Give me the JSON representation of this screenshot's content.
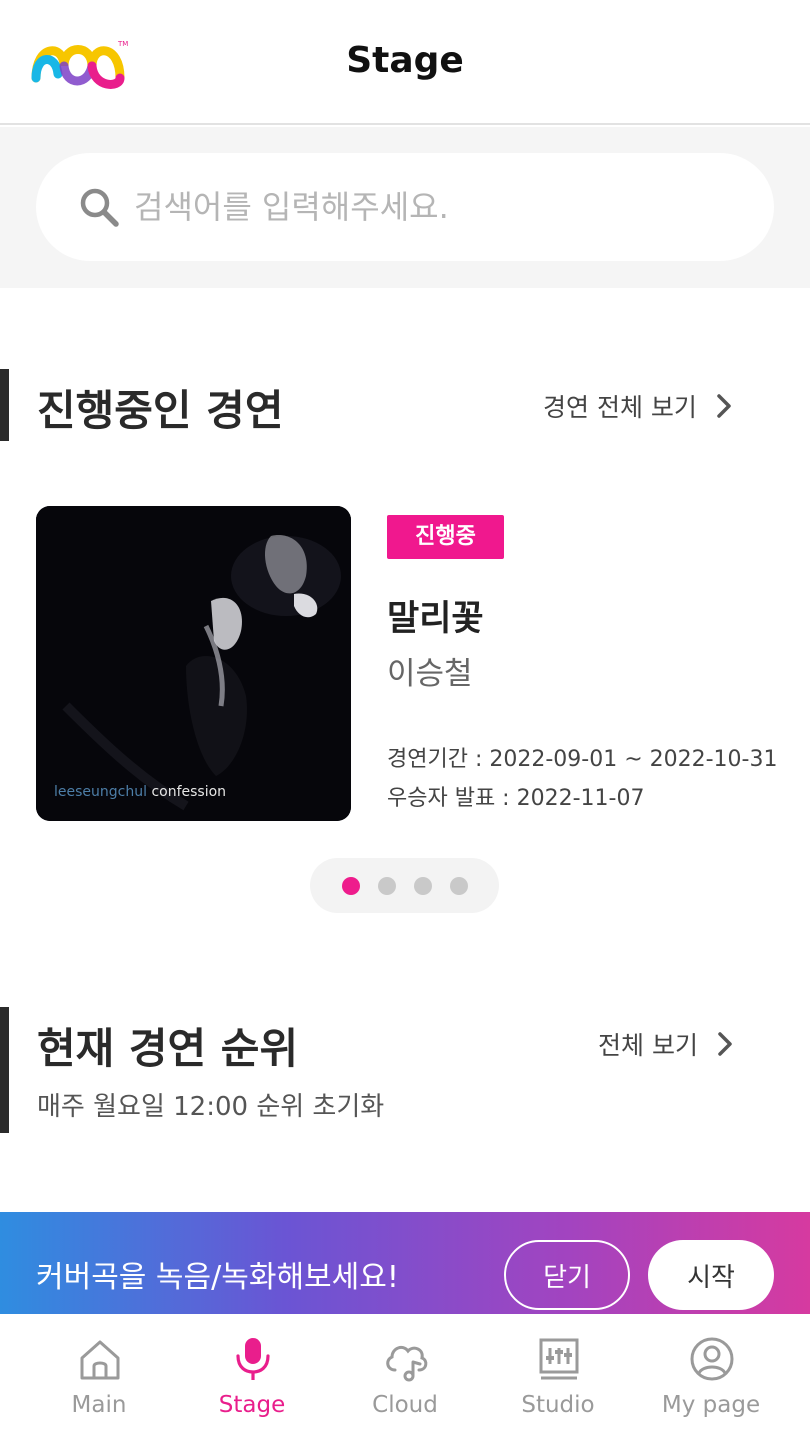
{
  "header": {
    "title": "Stage",
    "logo_icon": "mvm-logo-icon"
  },
  "search": {
    "placeholder": "검색어를 입력해주세요.",
    "value": ""
  },
  "ongoing_section": {
    "title": "진행중인 경연",
    "see_all_label": "경연 전체 보기",
    "card": {
      "status": "진행중",
      "song_title": "말리꽃",
      "artist": "이승철",
      "album_caption_artist": "leeseungchul",
      "album_caption_title": "confession",
      "period": "경연기간 : 2022-09-01 ~ 2022-10-31",
      "announce": "우승자 발표 : 2022-11-07"
    },
    "pagination": {
      "total": 4,
      "active_index": 0
    }
  },
  "ranking_section": {
    "title": "현재 경연 순위",
    "see_all_label": "전체 보기",
    "subtitle": "매주 월요일 12:00 순위 초기화"
  },
  "banner": {
    "text": "커버곡을 녹음/녹화해보세요!",
    "close_label": "닫기",
    "start_label": "시작"
  },
  "bottom_nav": {
    "items": [
      {
        "label": "Main",
        "icon": "home-icon",
        "active": false
      },
      {
        "label": "Stage",
        "icon": "microphone-icon",
        "active": true
      },
      {
        "label": "Cloud",
        "icon": "cloud-music-icon",
        "active": false
      },
      {
        "label": "Studio",
        "icon": "studio-mixer-icon",
        "active": false
      },
      {
        "label": "My page",
        "icon": "user-icon",
        "active": false
      }
    ]
  },
  "colors": {
    "accent": "#ee1c8c",
    "badge": "#f0188e",
    "banner_gradient": [
      "#2f8de0",
      "#6a55d4",
      "#a244c0",
      "#d63aa0"
    ],
    "inactive": "#9a9a9a"
  }
}
